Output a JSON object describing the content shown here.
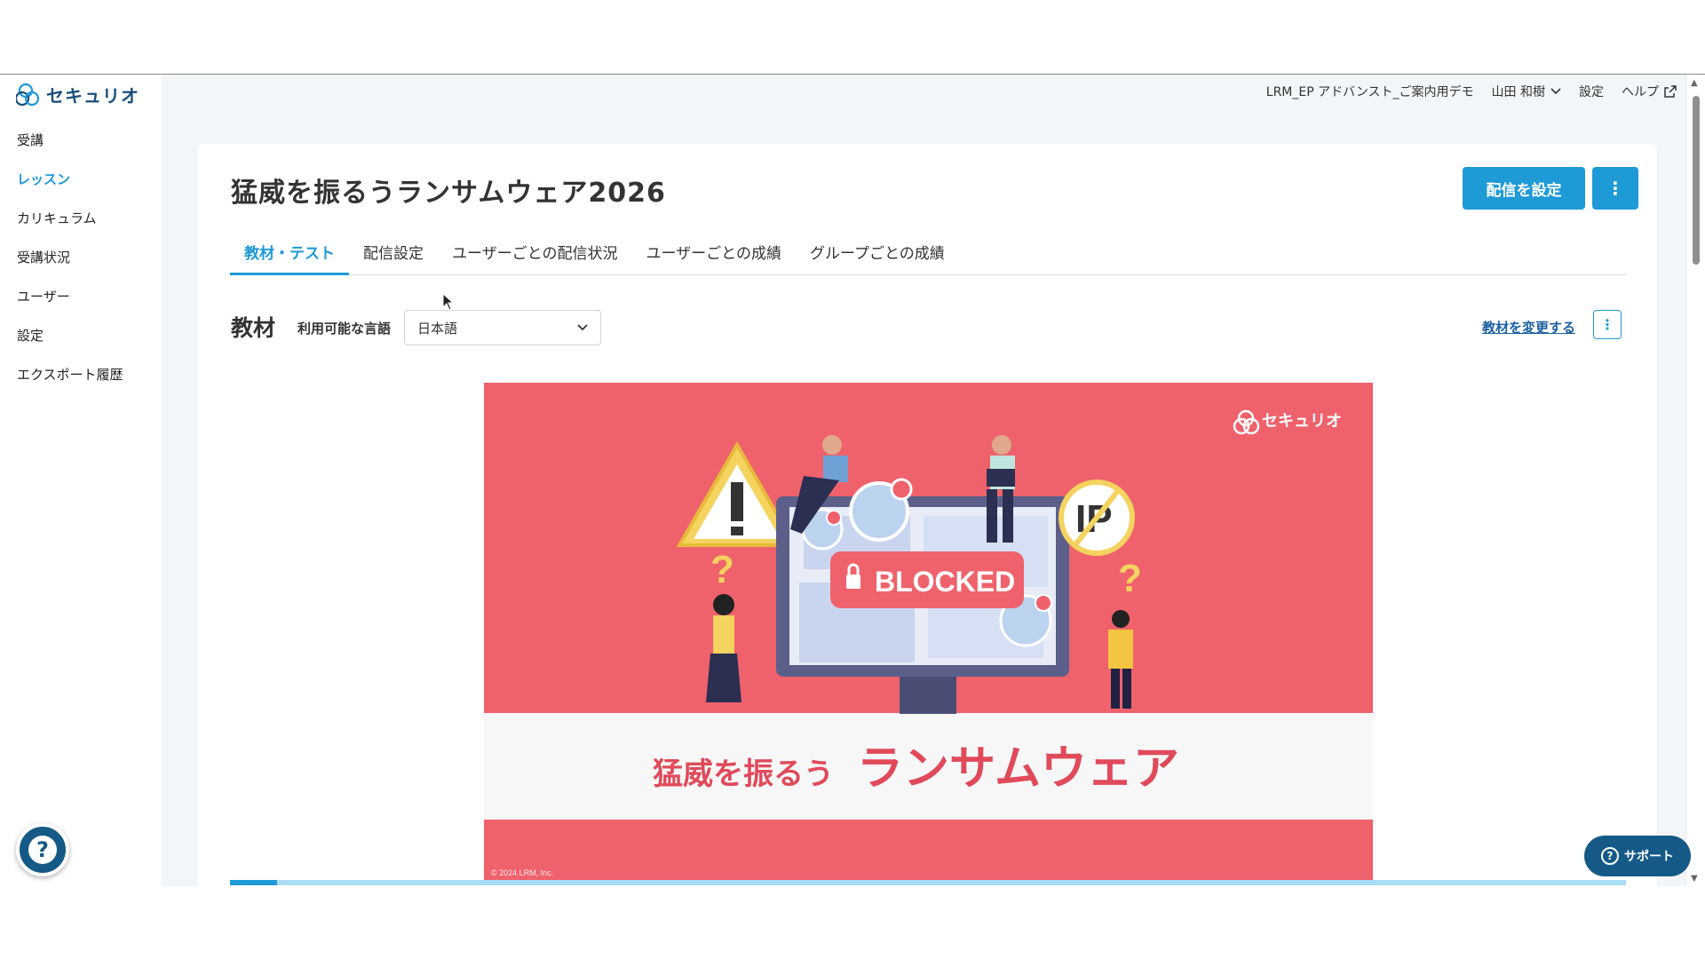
{
  "brand": {
    "name": "セキュリオ"
  },
  "sidebar": {
    "items": [
      {
        "label": "受講"
      },
      {
        "label": "レッスン",
        "active": true
      },
      {
        "label": "カリキュラム"
      },
      {
        "label": "受講状況"
      },
      {
        "label": "ユーザー"
      },
      {
        "label": "設定"
      },
      {
        "label": "エクスポート履歴"
      }
    ]
  },
  "topbar": {
    "org": "LRM_EP アドバンスト_ご案内用デモ",
    "user": "山田 和樹",
    "settings": "設定",
    "help": "ヘルプ"
  },
  "page": {
    "title": "猛威を振るうランサムウェア2026",
    "primary_button": "配信を設定"
  },
  "tabs": [
    {
      "label": "教材・テスト",
      "active": true
    },
    {
      "label": "配信設定"
    },
    {
      "label": "ユーザーごとの配信状況"
    },
    {
      "label": "ユーザーごとの成績"
    },
    {
      "label": "グループごとの成績"
    }
  ],
  "material": {
    "section_label": "教材",
    "language_label": "利用可能な言語",
    "language_value": "日本語",
    "change_link": "教材を変更する",
    "slide": {
      "brand": "セキュリオ",
      "badge": "BLOCKED",
      "ip_text": "IP",
      "title_small": "猛威を振るう",
      "title_large": "ランサムウェア",
      "copyright": "© 2024 LRM, Inc."
    },
    "progress": 0.034
  },
  "support": {
    "label": "サポート"
  },
  "colors": {
    "accent": "#1e9ad6",
    "slide_bg": "#ef626c",
    "dark_blue": "#155a86"
  }
}
